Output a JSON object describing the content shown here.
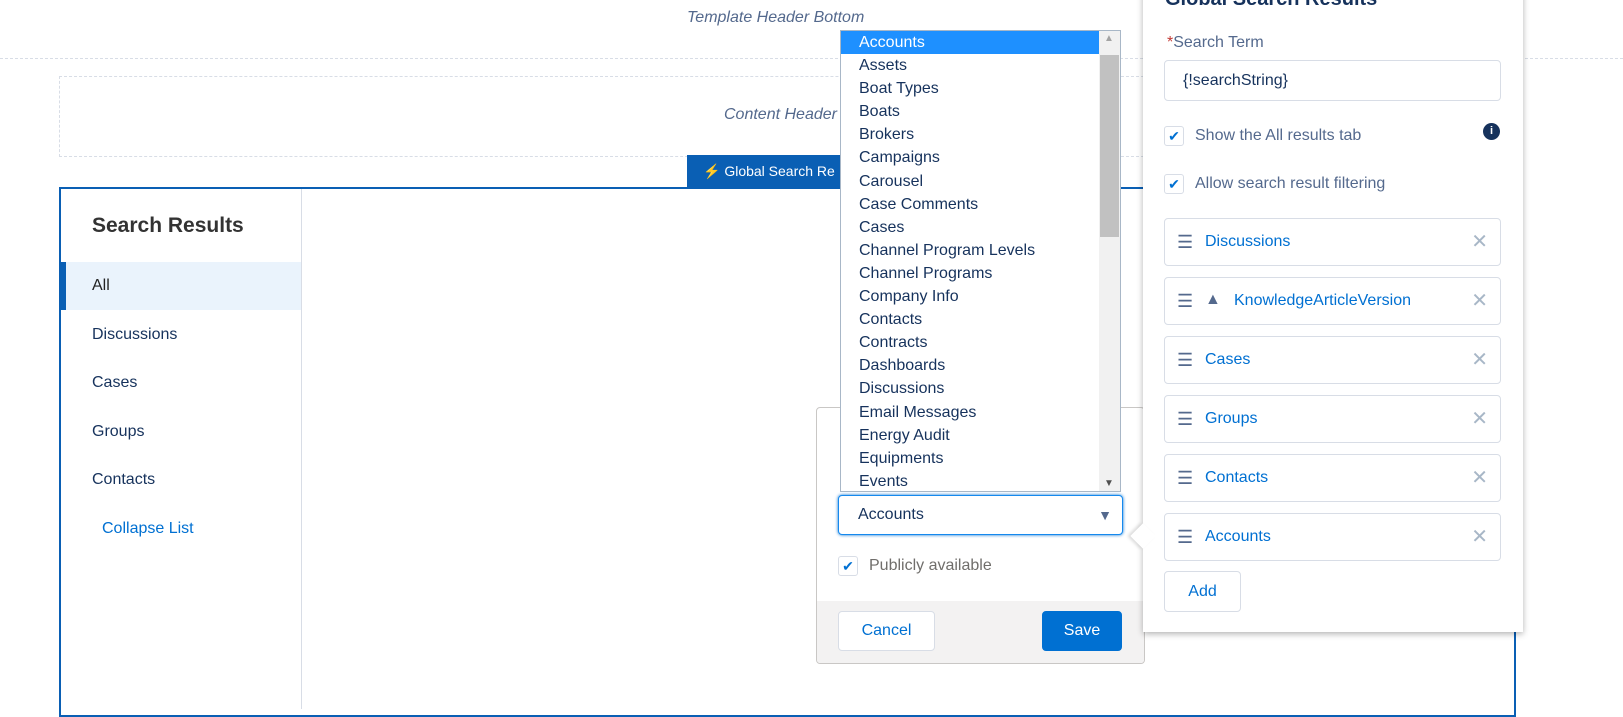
{
  "template_header": "Template Header Bottom",
  "content_header": "Content Header",
  "component_tab": {
    "label": "Global Search Re",
    "icon": "lightning-icon"
  },
  "sidebar": {
    "title": "Search Results",
    "items": [
      {
        "label": "All",
        "selected": true
      },
      {
        "label": "Discussions"
      },
      {
        "label": "Cases"
      },
      {
        "label": "Groups"
      },
      {
        "label": "Contacts"
      }
    ],
    "collapse": "Collapse List"
  },
  "dropdown": {
    "options": [
      "Accounts",
      "Assets",
      "Boat Types",
      "Boats",
      "Brokers",
      "Campaigns",
      "Carousel",
      "Case Comments",
      "Cases",
      "Channel Program Levels",
      "Channel Programs",
      "Company Info",
      "Contacts",
      "Contracts",
      "Dashboards",
      "Discussions",
      "Email Messages",
      "Energy Audit",
      "Equipments",
      "Events"
    ],
    "selected": "Accounts"
  },
  "popover": {
    "select_value": "Accounts",
    "public_label": "Publicly available",
    "public_checked": true,
    "cancel": "Cancel",
    "save": "Save"
  },
  "panel": {
    "title": "Global Search Results",
    "search_term_label": "Search Term",
    "required": "*",
    "search_term_value": "{!searchString}",
    "show_all_label": "Show the All results tab",
    "show_all_checked": true,
    "allow_filter_label": "Allow search result filtering",
    "allow_filter_checked": true,
    "objects": [
      {
        "label": "Discussions"
      },
      {
        "label": "KnowledgeArticleVersion",
        "warning": true
      },
      {
        "label": "Cases"
      },
      {
        "label": "Groups"
      },
      {
        "label": "Contacts"
      },
      {
        "label": "Accounts"
      }
    ],
    "add": "Add"
  },
  "colors": {
    "brand": "#0070d2",
    "tab": "#0a5fb4",
    "selected_option": "#1e90ff"
  }
}
